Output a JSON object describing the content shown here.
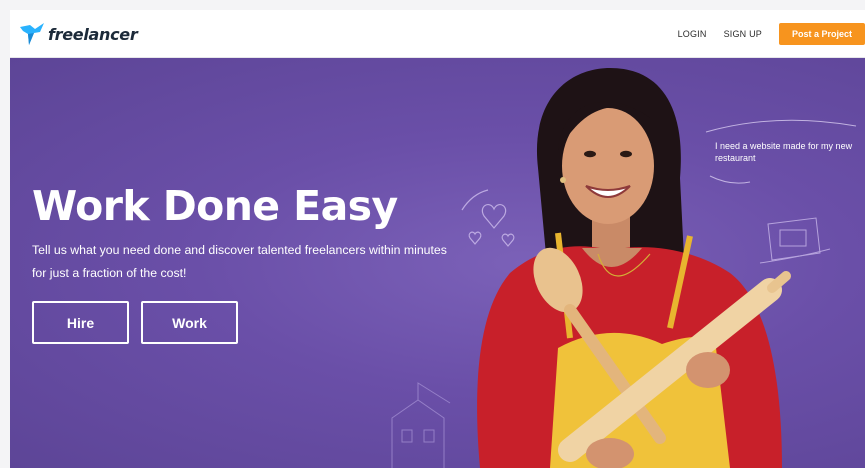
{
  "header": {
    "logo_text": "freelancer",
    "login_label": "LOGIN",
    "signup_label": "SIGN UP",
    "post_project_label": "Post a Project"
  },
  "hero": {
    "title": "Work Done Easy",
    "subtitle": "Tell us what you need done and discover talented freelancers within minutes for just a fraction of the cost!",
    "hire_label": "Hire",
    "work_label": "Work",
    "speech_bubble": "I need a website made for my new restaurant"
  },
  "colors": {
    "hero_bg": "#6a4fa8",
    "accent_orange": "#f7941e",
    "logo_blue": "#29b2fe"
  }
}
